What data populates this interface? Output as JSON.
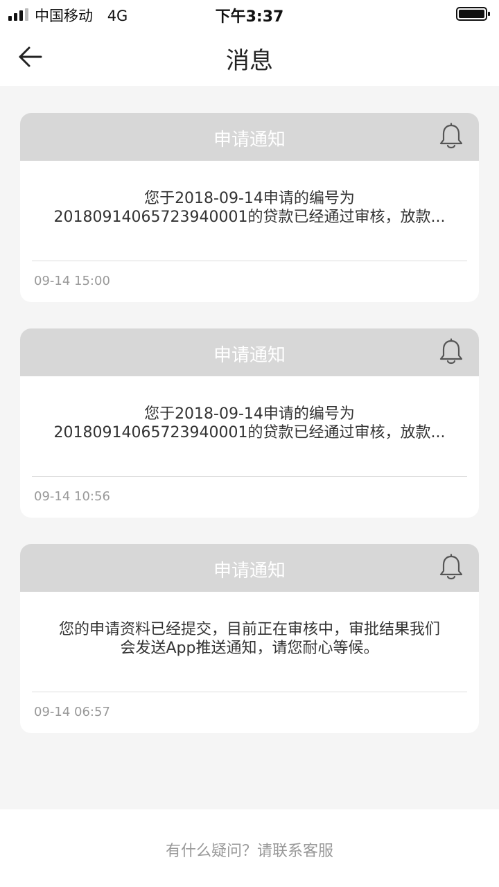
{
  "status_bar": {
    "carrier": "中国移动",
    "network": "4G",
    "time": "下午3:37"
  },
  "nav": {
    "title": "消息"
  },
  "messages": [
    {
      "title": "申请通知",
      "line1": "您于2018-09-14申请的编号为",
      "line2": "20180914065723940001的贷款已经通过审核，放款...",
      "time": "09-14 15:00"
    },
    {
      "title": "申请通知",
      "line1": "您于2018-09-14申请的编号为",
      "line2": "20180914065723940001的贷款已经通过审核，放款...",
      "time": "09-14 10:56"
    },
    {
      "title": "申请通知",
      "line1": "您的申请资料已经提交，目前正在审核中，审批结果我们",
      "line2": "会发送App推送通知，请您耐心等候。",
      "time": "09-14 06:57"
    }
  ],
  "footer": {
    "text": "有什么疑问？请联系客服"
  },
  "colors": {
    "header_bg": "#d7d7d7",
    "page_bg": "#f5f5f5",
    "muted_text": "#999999"
  },
  "icons": {
    "back": "arrow-left-icon",
    "bell": "bell-icon",
    "signal": "signal-icon",
    "battery": "battery-icon"
  }
}
